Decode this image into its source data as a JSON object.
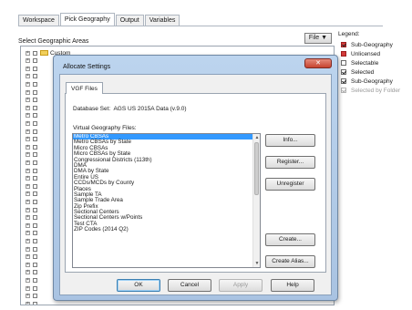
{
  "tabs": [
    {
      "label": "Workspace",
      "active": false
    },
    {
      "label": "Pick Geography",
      "active": true
    },
    {
      "label": "Output",
      "active": false
    },
    {
      "label": "Variables",
      "active": false
    }
  ],
  "section_label": "Select Geographic Areas",
  "file_button": "File ▼",
  "legend": {
    "title": "Legend:",
    "items": [
      {
        "label": "Sub-Geography"
      },
      {
        "label": "Unlicensed"
      },
      {
        "label": "Selectable"
      },
      {
        "label": "Selected"
      },
      {
        "label": "Sub-Geography"
      },
      {
        "label": "Selected by Folder"
      }
    ]
  },
  "tree": {
    "first_item": "Custom"
  },
  "dialog": {
    "title": "Allocate Settings",
    "close_label": "✕",
    "tab_label": "VGF Files",
    "database_label": "Database Set:",
    "database_value": "AGS US 2015A Data (v.9.0)",
    "vgf_label": "Virtual Geography Files:",
    "list": [
      "Metro CBSAs",
      "Metro CBSAs by State",
      "Micro CBSAs",
      "Micro CBSAs by State",
      "Congressional Districts (113th)",
      "DMA",
      "DMA by State",
      "Entire US",
      "CCDs/MCDs by County",
      "Places",
      "Sample TA",
      "Sample Trade Area",
      "Zip Prefix",
      "Sectional Centers",
      "Sectional Centers w/Points",
      "Test CTA",
      "ZIP Codes (2014 Q2)"
    ],
    "selected_index": 0,
    "buttons": {
      "info": "Info...",
      "register": "Register...",
      "unregister": "Unregister",
      "create": "Create...",
      "create_alias": "Create Alias..."
    },
    "footer": {
      "ok": "OK",
      "cancel": "Cancel",
      "apply": "Apply",
      "help": "Help"
    }
  },
  "colors": {
    "selection": "#3399ff",
    "dialog_frame": "#a9c3e2",
    "close_button": "#c6432f",
    "legend_red": "#d23a3a"
  }
}
